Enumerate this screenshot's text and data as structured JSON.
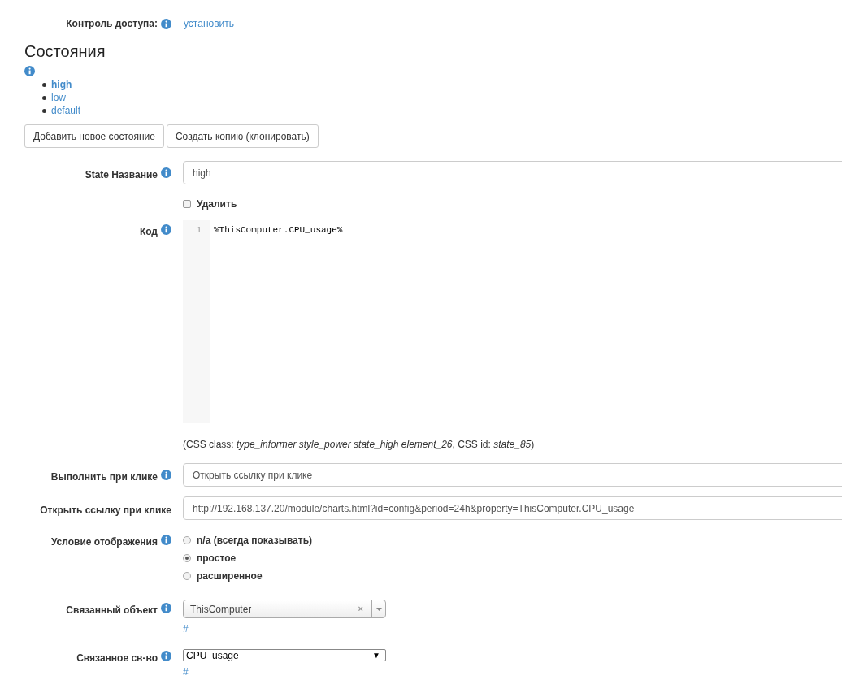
{
  "access_control": {
    "label": "Контроль доступа:",
    "info": true,
    "link": "установить"
  },
  "states_section": {
    "title": "Состояния",
    "info": true,
    "states": [
      {
        "label": "high",
        "selected": true
      },
      {
        "label": "low",
        "selected": false
      },
      {
        "label": "default",
        "selected": false
      }
    ],
    "buttons": [
      "Добавить новое состояние",
      "Создать копию (клонировать)"
    ]
  },
  "form": [
    {
      "kind": "text",
      "label": "State Название",
      "info": true,
      "value": "high"
    },
    {
      "kind": "checkbox",
      "label": "Удалить",
      "checked": false
    },
    {
      "kind": "code",
      "label": "Код",
      "info": true,
      "line_numbers": [
        "1"
      ],
      "lines": [
        "%ThisComputer.CPU_usage%"
      ]
    },
    {
      "kind": "note",
      "text": "(CSS class: *type_informer style_power state_high element_26*, CSS id: *state_85*)"
    },
    {
      "kind": "text",
      "label": "Выполнить при клике",
      "info": true,
      "value": "Открыть ссылку при клике"
    },
    {
      "kind": "text",
      "label": "Открыть ссылку при клике",
      "info": false,
      "value": "http://192.168.137.20/module/charts.html?id=config&period=24h&property=ThisComputer.CPU_usage"
    },
    {
      "kind": "radio",
      "label": "Условие отображения",
      "info": true,
      "options": [
        {
          "label": "n/a (всегда показывать)",
          "selected": false
        },
        {
          "label": "простое",
          "selected": true
        },
        {
          "label": "расширенное",
          "selected": false
        }
      ]
    },
    {
      "kind": "combo",
      "label": "Связанный объект",
      "info": true,
      "value": "ThisComputer",
      "clear": "×",
      "link": "#"
    },
    {
      "kind": "select",
      "label": "Связанное св-во",
      "info": true,
      "value": "CPU_usage",
      "arrow": "▼",
      "link": "#"
    }
  ]
}
